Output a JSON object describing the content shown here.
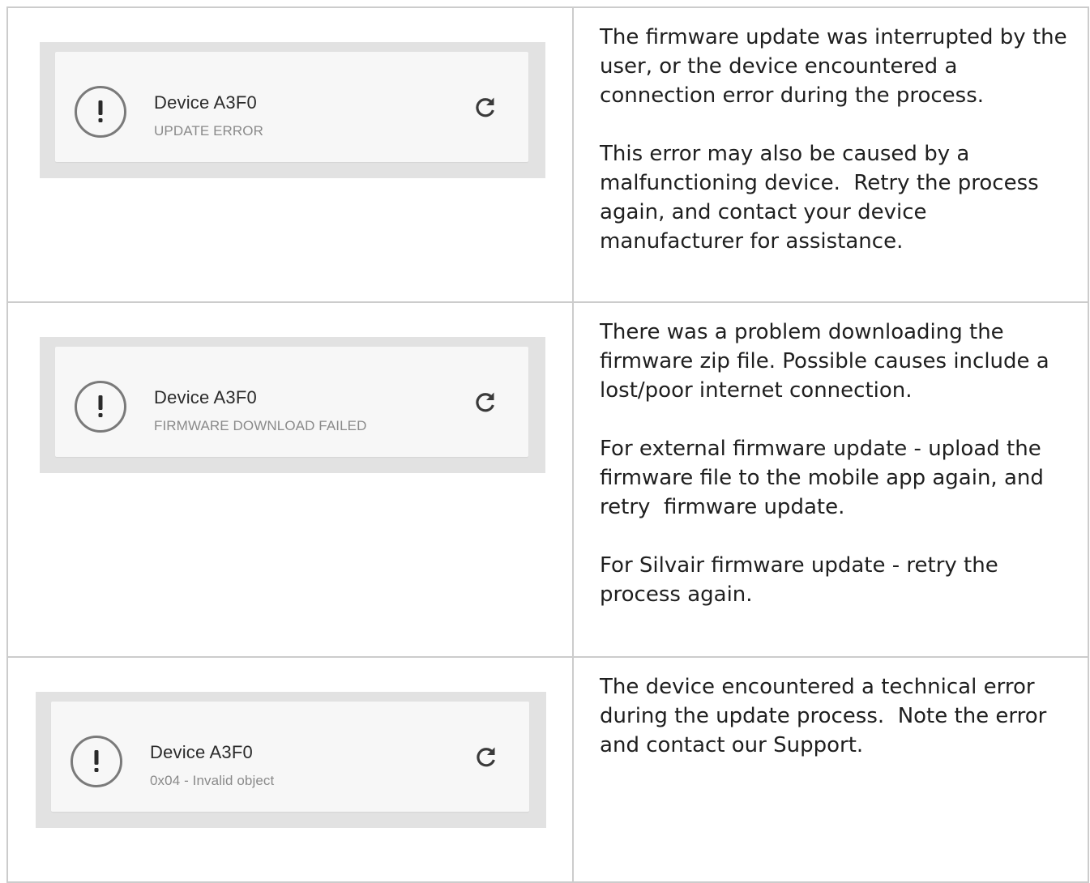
{
  "rows": [
    {
      "card": {
        "device_name": "Device  A3F0",
        "status": "UPDATE ERROR",
        "icons": {
          "alert": "exclamation-circle-icon",
          "action": "retry-icon"
        }
      },
      "paragraphs": [
        "The firmware update was interrupted by the user, or the device encountered a connection error during the process.",
        "This error may also be caused by a malfunctioning device.  Retry the process again, and contact your device manufacturer for assistance."
      ]
    },
    {
      "card": {
        "device_name": "Device  A3F0",
        "status": "FIRMWARE DOWNLOAD FAILED",
        "icons": {
          "alert": "exclamation-circle-icon",
          "action": "retry-icon"
        }
      },
      "paragraphs": [
        "There was a problem downloading the firmware zip file. Possible causes include a lost/poor internet connection.",
        "For external firmware update - upload the firmware file to the mobile app again, and retry  firmware update.",
        "For Silvair firmware update - retry the process again."
      ]
    },
    {
      "card": {
        "device_name": "Device  A3F0",
        "status": "0x04 - Invalid object",
        "icons": {
          "alert": "exclamation-circle-icon",
          "action": "retry-icon"
        }
      },
      "paragraphs": [
        "The device encountered a technical error during the update process.  Note the error and contact our Support."
      ]
    }
  ],
  "colors": {
    "border": "#cccccc",
    "shot_background": "#e2e2e2",
    "card_background": "#f7f7f7",
    "icon_gray": "#7a7a7a",
    "status_gray": "#8a8a8a"
  }
}
